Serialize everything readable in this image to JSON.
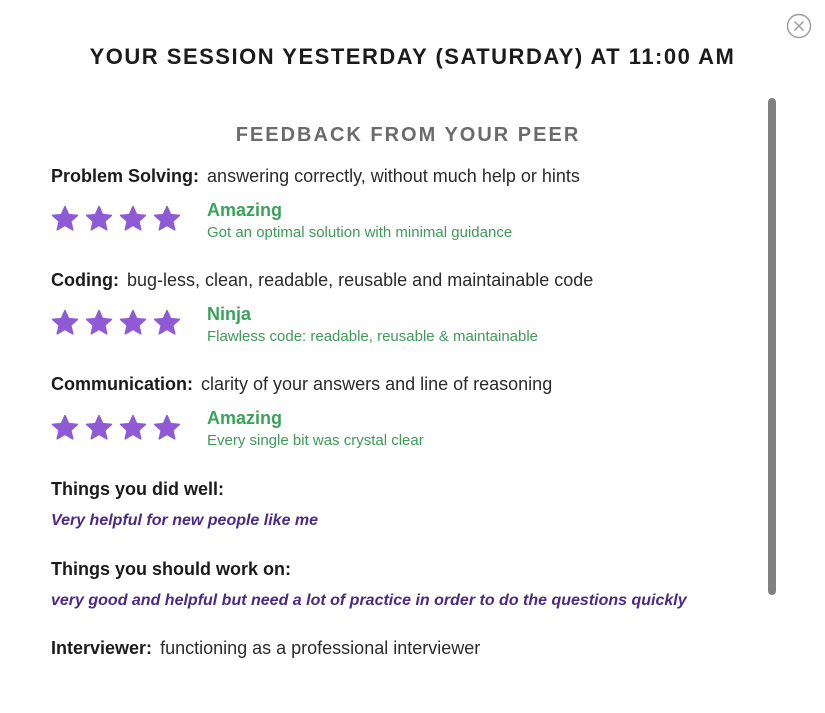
{
  "modal": {
    "title": "YOUR SESSION YESTERDAY (SATURDAY) AT 11:00 AM",
    "close_icon": "close-circle-icon"
  },
  "feedback": {
    "heading": "FEEDBACK FROM YOUR PEER",
    "star_color": "#8e5ad6",
    "rating_color": "#3aa25a",
    "criteria": [
      {
        "name": "Problem Solving:",
        "description": "answering correctly, without much help or hints",
        "stars": 4,
        "rating_label": "Amazing",
        "rating_description": "Got an optimal solution with minimal guidance"
      },
      {
        "name": "Coding:",
        "description": "bug-less, clean, readable, reusable and maintainable code",
        "stars": 4,
        "rating_label": "Ninja",
        "rating_description": "Flawless code: readable, reusable & maintainable"
      },
      {
        "name": "Communication:",
        "description": "clarity of your answers and line of reasoning",
        "stars": 4,
        "rating_label": "Amazing",
        "rating_description": "Every single bit was crystal clear"
      }
    ],
    "did_well": {
      "heading": "Things you did well:",
      "answer": "Very helpful for new people like me"
    },
    "work_on": {
      "heading": "Things you should work on:",
      "answer": "very good and helpful but need a lot of practice in order to do the questions quickly"
    },
    "interviewer": {
      "name": "Interviewer:",
      "description": "functioning as a professional interviewer"
    }
  }
}
